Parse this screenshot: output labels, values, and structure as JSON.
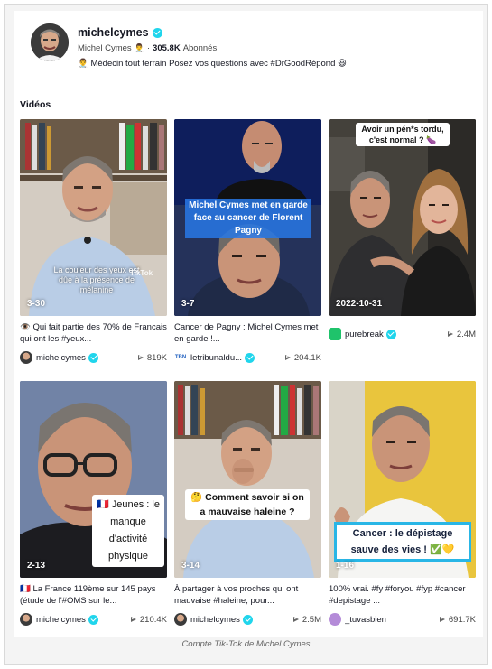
{
  "profile": {
    "username": "michelcymes",
    "display_name": "Michel Cymes",
    "display_emoji": "👨‍⚕️",
    "followers_count": "305.8K",
    "followers_label": "Abonnés",
    "bio": "👨‍⚕️ Médecin tout terrain Posez vos questions avec #DrGoodRépond 😃"
  },
  "section_title": "Vidéos",
  "videos": [
    {
      "overlay_label": "3-30",
      "caption_text": "La couleur des yeux est dûe à la présence de mélanine",
      "description": "👁️ Qui fait partie des 70% de Francais qui ont les #yeux...",
      "author": "michelcymes",
      "verified": true,
      "plays": "819K"
    },
    {
      "overlay_label": "3-7",
      "caption_text": "Michel Cymes met en garde face au cancer de Florent Pagny",
      "description": "Cancer de Pagny : Michel Cymes met en garde !...",
      "author": "letribunaldu...",
      "verified": true,
      "plays": "204.1K"
    },
    {
      "overlay_label": "2022-10-31",
      "caption_text": "Avoir un pén*s tordu, c'est normal ? 🍆",
      "description": "",
      "author": "purebreak",
      "verified": true,
      "plays": "2.4M"
    },
    {
      "overlay_label": "2-13",
      "caption_text": "🇫🇷 Jeunes : le manque d'activité physique",
      "description": "🇫🇷 La France 119ème sur 145 pays (étude de l'#OMS sur le...",
      "author": "michelcymes",
      "verified": true,
      "plays": "210.4K"
    },
    {
      "overlay_label": "3-14",
      "caption_text": "🤔 Comment savoir si on a mauvaise haleine ?",
      "description": "À partager à vos proches qui ont mauvaise #haleine, pour...",
      "author": "michelcymes",
      "verified": true,
      "plays": "2.5M"
    },
    {
      "overlay_label": "1-16",
      "caption_text": "Cancer : le dépistage sauve des vies ! ✅💛",
      "description": "100% vrai. #fy #foryou #fyp #cancer #depistage ...",
      "author": "_tuvasbien",
      "verified": false,
      "plays": "691.7K"
    }
  ],
  "watermark": "TikTok",
  "figure_caption": "Compte Tik-Tok de Michel Cymes",
  "colors": {
    "verified_badge": "#20d5ec",
    "tiktok_text": "#161823"
  },
  "icons": [
    "verified-icon",
    "play-icon"
  ]
}
